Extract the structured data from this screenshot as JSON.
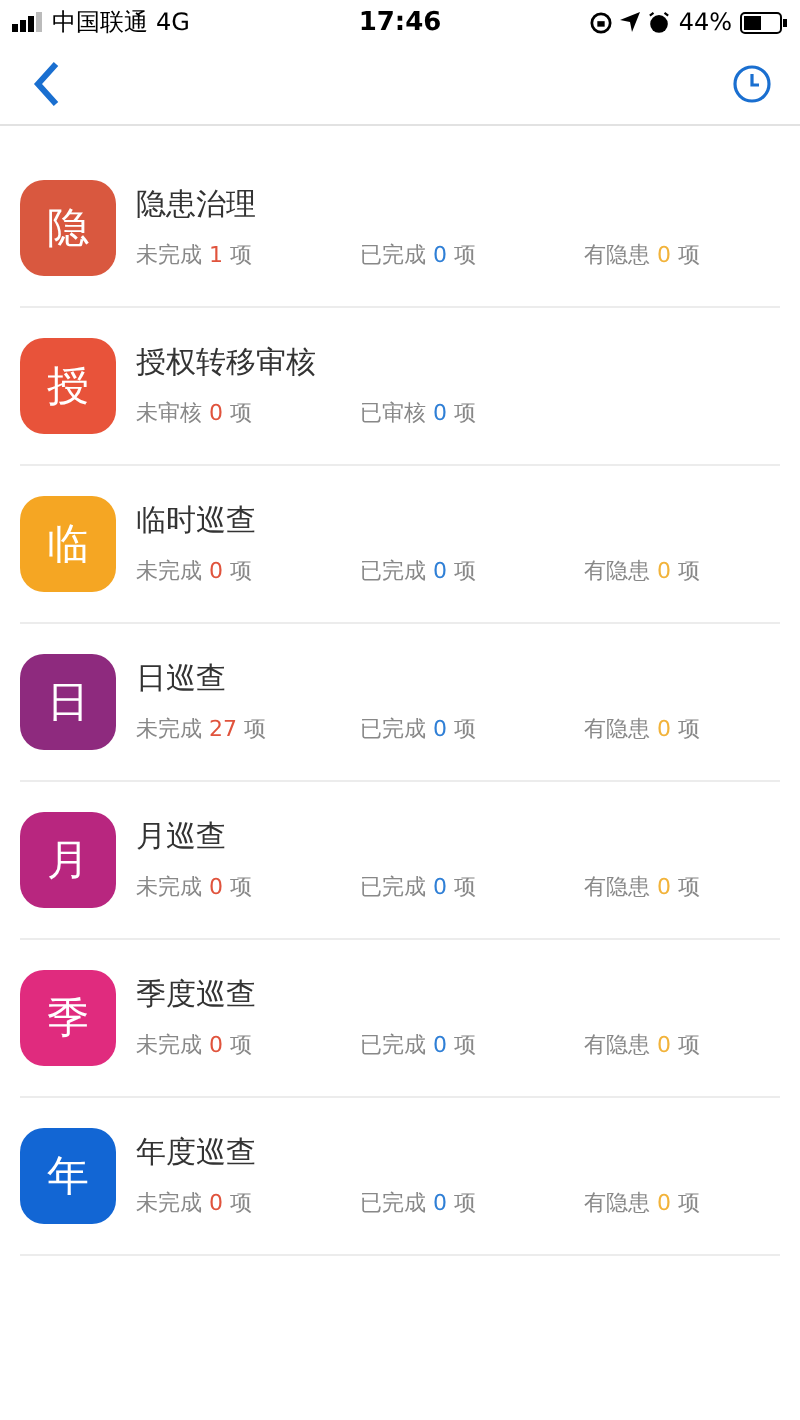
{
  "status_bar": {
    "carrier": "中国联通",
    "network": "4G",
    "time": "17:46",
    "battery": "44%"
  },
  "items": [
    {
      "glyph": "隐",
      "color": "#d9583f",
      "title": "隐患治理",
      "stats": [
        {
          "label": "未完成",
          "count": "1",
          "unit": "项",
          "color": "#e0533c"
        },
        {
          "label": "已完成",
          "count": "0",
          "unit": "项",
          "color": "#2f7fd6"
        },
        {
          "label": "有隐患",
          "count": "0",
          "unit": "项",
          "color": "#f2b33a"
        }
      ]
    },
    {
      "glyph": "授",
      "color": "#e8533a",
      "title": "授权转移审核",
      "stats": [
        {
          "label": "未审核",
          "count": "0",
          "unit": "项",
          "color": "#e0533c"
        },
        {
          "label": "已审核",
          "count": "0",
          "unit": "项",
          "color": "#2f7fd6"
        }
      ]
    },
    {
      "glyph": "临",
      "color": "#f5a623",
      "title": "临时巡查",
      "stats": [
        {
          "label": "未完成",
          "count": "0",
          "unit": "项",
          "color": "#e0533c"
        },
        {
          "label": "已完成",
          "count": "0",
          "unit": "项",
          "color": "#2f7fd6"
        },
        {
          "label": "有隐患",
          "count": "0",
          "unit": "项",
          "color": "#f2b33a"
        }
      ]
    },
    {
      "glyph": "日",
      "color": "#8e2a7e",
      "title": "日巡查",
      "stats": [
        {
          "label": "未完成",
          "count": "27",
          "unit": "项",
          "color": "#e0533c"
        },
        {
          "label": "已完成",
          "count": "0",
          "unit": "项",
          "color": "#2f7fd6"
        },
        {
          "label": "有隐患",
          "count": "0",
          "unit": "项",
          "color": "#f2b33a"
        }
      ]
    },
    {
      "glyph": "月",
      "color": "#b8267f",
      "title": "月巡查",
      "stats": [
        {
          "label": "未完成",
          "count": "0",
          "unit": "项",
          "color": "#e0533c"
        },
        {
          "label": "已完成",
          "count": "0",
          "unit": "项",
          "color": "#2f7fd6"
        },
        {
          "label": "有隐患",
          "count": "0",
          "unit": "项",
          "color": "#f2b33a"
        }
      ]
    },
    {
      "glyph": "季",
      "color": "#e02b7e",
      "title": "季度巡查",
      "stats": [
        {
          "label": "未完成",
          "count": "0",
          "unit": "项",
          "color": "#e0533c"
        },
        {
          "label": "已完成",
          "count": "0",
          "unit": "项",
          "color": "#2f7fd6"
        },
        {
          "label": "有隐患",
          "count": "0",
          "unit": "项",
          "color": "#f2b33a"
        }
      ]
    },
    {
      "glyph": "年",
      "color": "#1266d4",
      "title": "年度巡查",
      "stats": [
        {
          "label": "未完成",
          "count": "0",
          "unit": "项",
          "color": "#e0533c"
        },
        {
          "label": "已完成",
          "count": "0",
          "unit": "项",
          "color": "#2f7fd6"
        },
        {
          "label": "有隐患",
          "count": "0",
          "unit": "项",
          "color": "#f2b33a"
        }
      ]
    }
  ]
}
